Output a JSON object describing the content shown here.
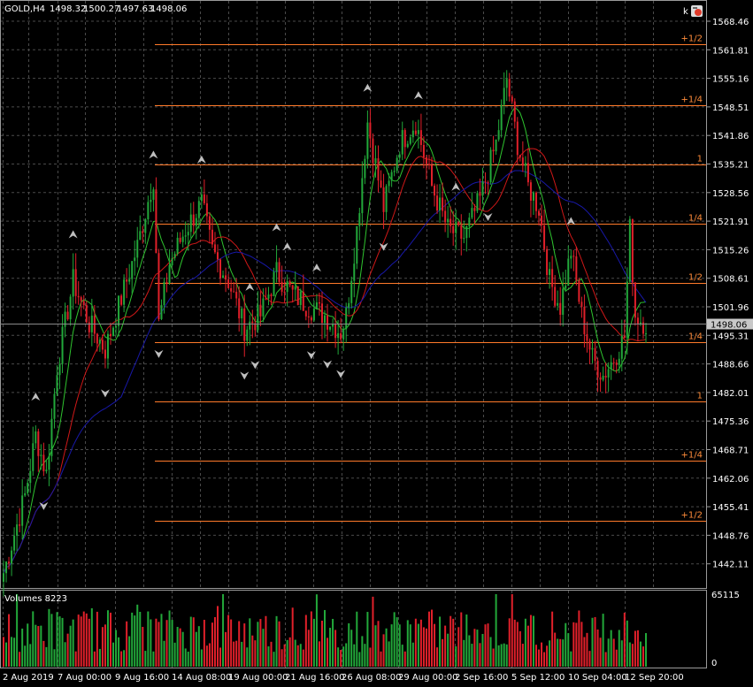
{
  "header": {
    "symbol": "GOLD,H4",
    "open": "1498.32",
    "high": "1500.27",
    "low": "1497.63",
    "close": "1498.06"
  },
  "toolbar": {
    "k_label": "k"
  },
  "chart_data": {
    "type": "candlestick",
    "title": "",
    "price_axis_ticks": [
      "1568.46",
      "1561.81",
      "1555.16",
      "1548.51",
      "1541.86",
      "1535.21",
      "1528.56",
      "1521.91",
      "1515.26",
      "1508.61",
      "1501.96",
      "1495.31",
      "1488.66",
      "1482.01",
      "1475.36",
      "1468.71",
      "1462.06",
      "1455.41",
      "1448.76",
      "1442.11"
    ],
    "ylim": [
      1437.0,
      1572.0
    ],
    "current_price": "1498.06",
    "time_axis_ticks": [
      "2 Aug 2019",
      "7 Aug 00:00",
      "9 Aug 16:00",
      "14 Aug 08:00",
      "19 Aug 00:00",
      "21 Aug 16:00",
      "26 Aug 08:00",
      "29 Aug 00:00",
      "2 Sep 16:00",
      "5 Sep 12:00",
      "10 Sep 04:00",
      "12 Sep 20:00"
    ],
    "levels": [
      {
        "label": "+1/2",
        "price": 1563.2
      },
      {
        "label": "+1/4",
        "price": 1548.9
      },
      {
        "label": "1",
        "price": 1535.2
      },
      {
        "label": "1/4",
        "price": 1521.4
      },
      {
        "label": "1/2",
        "price": 1507.5
      },
      {
        "label": "1/4",
        "price": 1493.7
      },
      {
        "label": "1",
        "price": 1479.9
      },
      {
        "label": "+1/4",
        "price": 1466.1
      },
      {
        "label": "+1/2",
        "price": 1452.2
      }
    ],
    "grid": true,
    "volumes": {
      "label": "Volumes 8223",
      "axis_ticks": [
        "65115",
        "0"
      ],
      "max": 65115
    },
    "colors": {
      "up": "#22a83a",
      "down": "#e0202a",
      "ma_fast": "#2fc42f",
      "ma_mid": "#d01818",
      "ma_slow": "#1818a8",
      "level": "#ff7a2a",
      "grid": "#4a4a4a",
      "price_line": "#8a8a8a"
    }
  }
}
